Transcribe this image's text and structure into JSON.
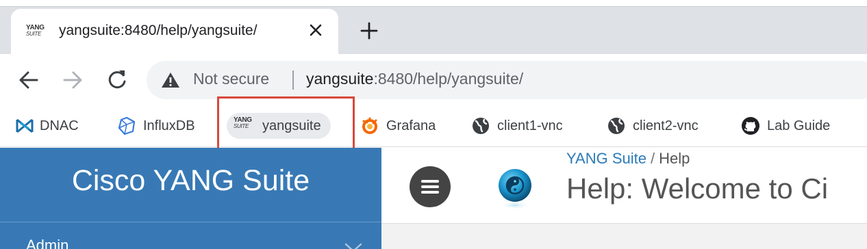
{
  "browser": {
    "tab": {
      "favicon_top": "YANG",
      "favicon_bottom": "SUITE",
      "title": "yangsuite:8480/help/yangsuite/"
    },
    "omnibox": {
      "security_label": "Not secure",
      "url_host": "yangsuite",
      "url_rest": ":8480/help/yangsuite/"
    },
    "bookmarks": [
      {
        "label": "DNAC",
        "icon": "dnac-icon"
      },
      {
        "label": "InfluxDB",
        "icon": "influxdb-icon"
      },
      {
        "label": "yangsuite",
        "icon": "yangsuite-icon",
        "icon_top": "YANG",
        "icon_bottom": "SUITE"
      },
      {
        "label": "Grafana",
        "icon": "grafana-icon"
      },
      {
        "label": "client1-vnc",
        "icon": "globe-icon"
      },
      {
        "label": "client2-vnc",
        "icon": "globe-icon"
      },
      {
        "label": "Lab Guide",
        "icon": "github-icon"
      }
    ],
    "highlight_color": "#d9483b"
  },
  "app": {
    "brand": "Cisco YANG Suite",
    "sidebar_color": "#3879b5",
    "nav": [
      {
        "label": "Admin"
      }
    ],
    "breadcrumb": {
      "home": "YANG Suite",
      "separator": "/",
      "current": "Help"
    },
    "page_title": "Help: Welcome to Ci"
  }
}
